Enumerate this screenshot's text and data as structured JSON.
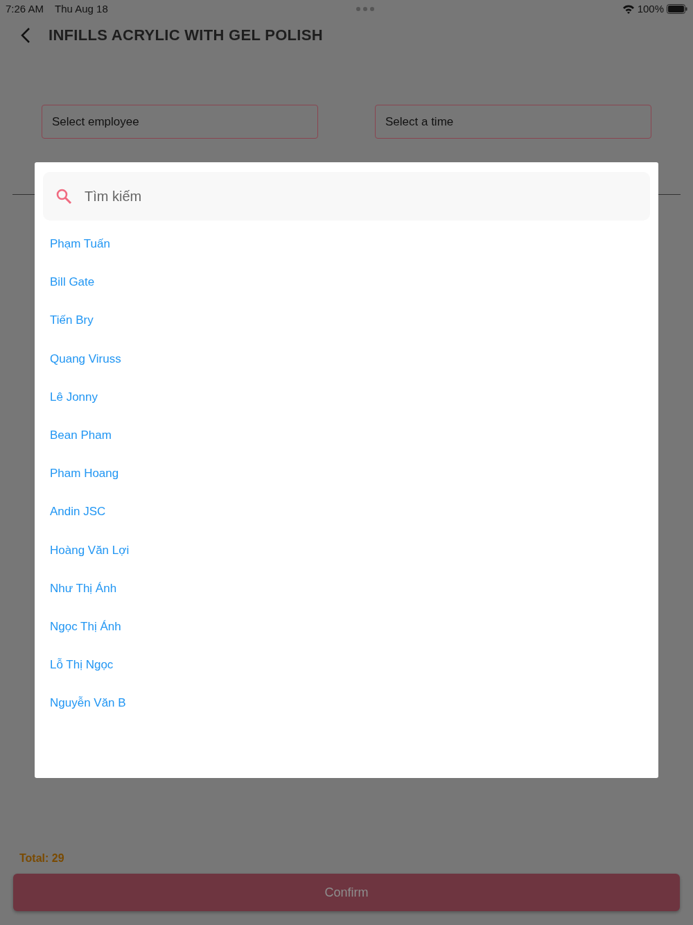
{
  "status_bar": {
    "time": "7:26 AM",
    "date": "Thu Aug 18",
    "battery": "100%"
  },
  "header": {
    "title": "INFILLS ACRYLIC WITH GEL POLISH"
  },
  "selectors": [
    {
      "label": "Select employee"
    },
    {
      "label": "Select a time"
    }
  ],
  "dialog": {
    "search": {
      "placeholder": "Tìm kiếm"
    },
    "items": [
      {
        "label": "Phạm Tuấn"
      },
      {
        "label": "Bill Gate"
      },
      {
        "label": "Tiến Bry"
      },
      {
        "label": "Quang Viruss"
      },
      {
        "label": "Lê Jonny"
      },
      {
        "label": "Bean Pham"
      },
      {
        "label": "Pham Hoang"
      },
      {
        "label": "Andin JSC"
      },
      {
        "label": "Hoàng Văn Lợi"
      },
      {
        "label": "Như Thị Ánh"
      },
      {
        "label": "Ngọc Thị Ánh"
      },
      {
        "label": "Lỗ Thị Ngọc"
      },
      {
        "label": "Nguyễn Văn B"
      }
    ]
  },
  "total": "Total: 29",
  "confirm_button": {
    "label": "Confirm",
    "disabled": true
  }
}
